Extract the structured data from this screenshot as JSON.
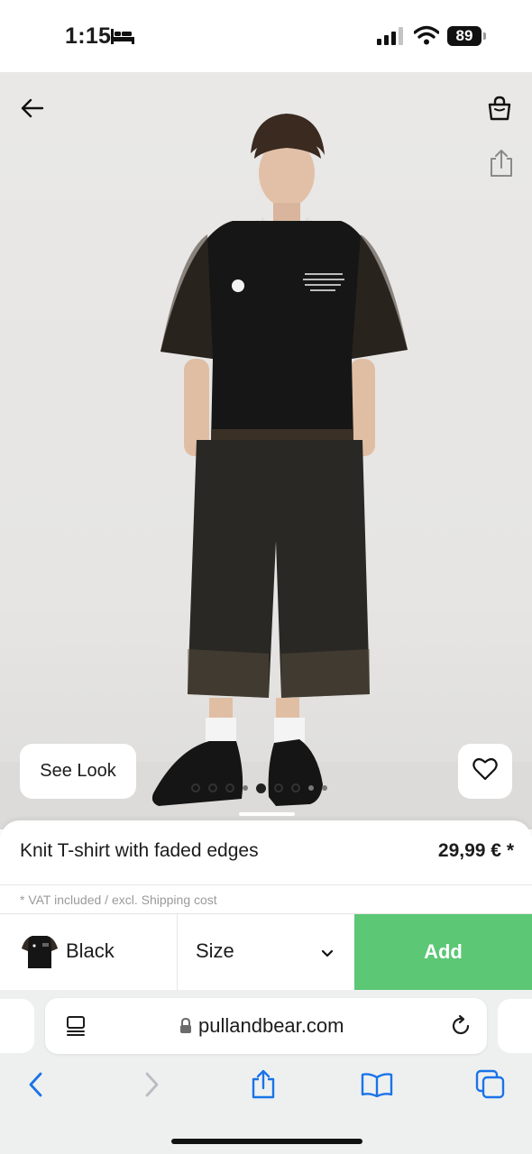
{
  "status_bar": {
    "time": "1:15",
    "battery": "89",
    "icons": [
      "bed-icon",
      "signal-icon",
      "wifi-icon",
      "battery-icon"
    ]
  },
  "photo_nav": {
    "icons": [
      "back-arrow-icon",
      "shopping-bag-icon",
      "share-icon"
    ]
  },
  "gallery": {
    "see_look_label": "See Look",
    "favorite_icon": "heart-outline-icon",
    "slides_total": 9,
    "active_slide": 5
  },
  "product": {
    "name": "Knit T-shirt with faded edges",
    "price": "29,99 € *",
    "vat_note": "* VAT included / excl. Shipping cost",
    "color_label": "Black",
    "size_label": "Size",
    "add_label": "Add"
  },
  "browser": {
    "url": "pullandbear.com",
    "icons": [
      "reader-mode-icon",
      "lock-icon",
      "reload-icon",
      "back-icon",
      "forward-icon",
      "share-icon",
      "bookmarks-icon",
      "tabs-icon"
    ]
  },
  "colors": {
    "accent_green": "#5cc775",
    "safari_blue": "#1a73e8",
    "photo_background": "#e8e7e5"
  }
}
